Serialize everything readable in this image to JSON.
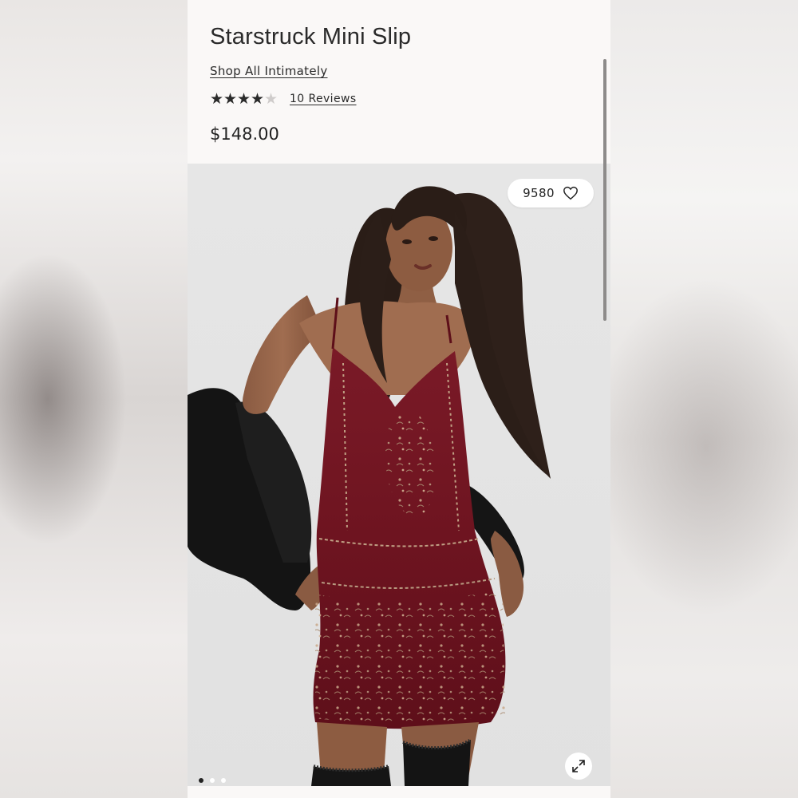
{
  "product": {
    "title": "Starstruck Mini Slip",
    "collection_link": "Shop All Intimately",
    "rating": 4,
    "rating_max": 5,
    "reviews_label": "10 Reviews",
    "price": "$148.00"
  },
  "gallery": {
    "like_count": "9580",
    "like_icon": "heart-outline-icon",
    "expand_icon": "expand-arrows-icon",
    "slide_count": 3,
    "active_slide": 1
  },
  "colors": {
    "dress": "#6e1420",
    "text": "#2a2a2a",
    "background": "#faf8f7"
  }
}
